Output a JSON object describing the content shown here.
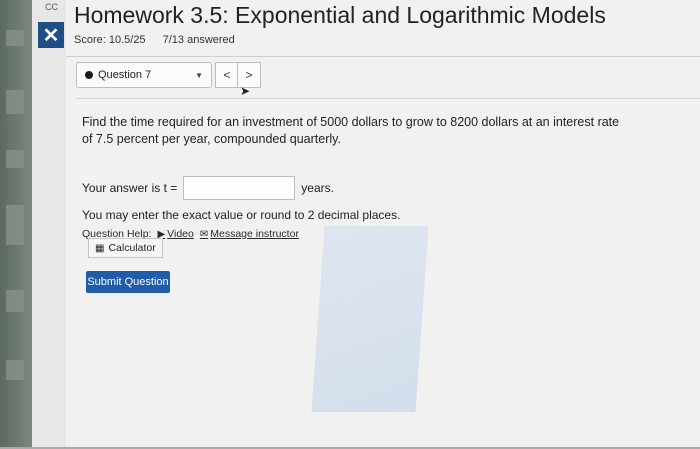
{
  "header": {
    "logo_text": "CC",
    "title": "Homework 3.5: Exponential and Logarithmic Models",
    "score": "Score: 10.5/25",
    "answered": "7/13 answered"
  },
  "nav": {
    "question_label": "Question 7",
    "prev": "<",
    "next": ">"
  },
  "question": {
    "text": "Find the time required for an investment of 5000 dollars to grow to 8200 dollars at an interest rate of 7.5 percent per year, compounded quarterly.",
    "answer_prefix": "Your answer is t =",
    "answer_value": "",
    "answer_suffix": "years.",
    "hint": "You may enter the exact value or round to 2 decimal places."
  },
  "help": {
    "label": "Question Help:",
    "video": "Video",
    "message": "Message instructor",
    "calculator": "Calculator"
  },
  "actions": {
    "submit": "Submit Question"
  },
  "colors": {
    "close_bg": "#1d4f86",
    "submit_bg": "#1f5da8"
  }
}
